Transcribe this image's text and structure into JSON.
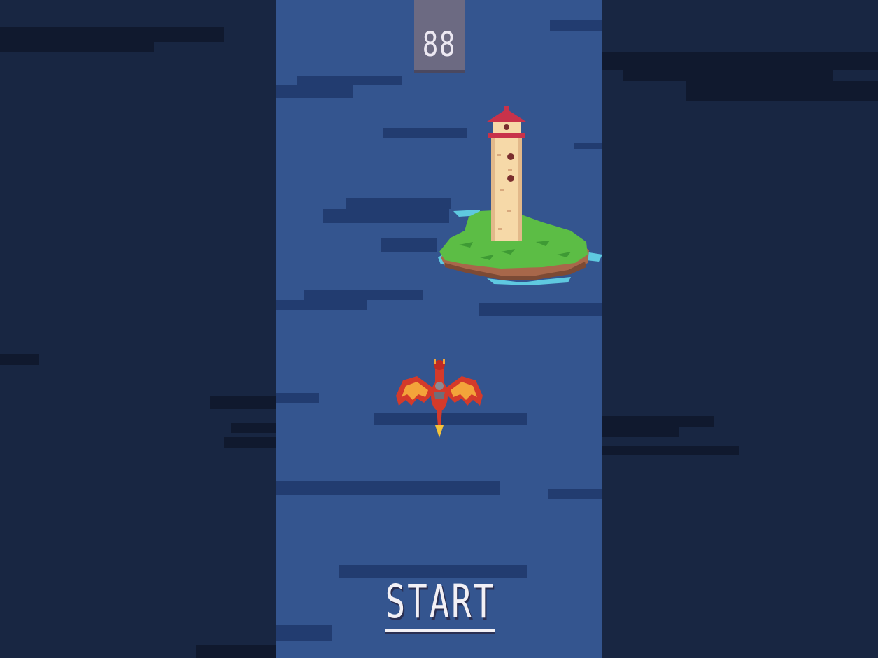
{
  "game": {
    "score": "88",
    "start_label": "START"
  },
  "icons": {
    "island": "lighthouse-island-icon",
    "player": "red-dragon-icon"
  },
  "colors": {
    "sky": "#34558f",
    "cloud_shadow": "#223c70",
    "letterbox": "#182642",
    "score_box": "#6c6a82",
    "text": "#f2f0f5"
  }
}
